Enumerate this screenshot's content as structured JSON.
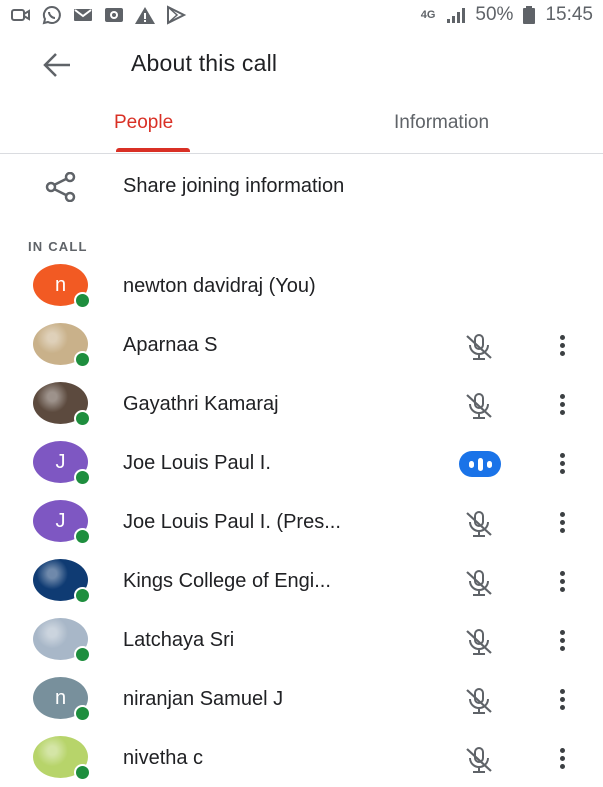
{
  "status_bar": {
    "left_icons": [
      "video-notification-icon",
      "whatsapp-icon",
      "mail-icon",
      "photo-icon",
      "warning-icon",
      "play-store-icon"
    ],
    "network_label": "4G",
    "battery": "50%",
    "time": "15:45"
  },
  "header": {
    "title": "About this call",
    "back_icon": "arrow-back-icon"
  },
  "tabs": [
    {
      "label": "People",
      "selected": true
    },
    {
      "label": "Information",
      "selected": false
    }
  ],
  "share": {
    "label": "Share joining information",
    "icon": "share-icon"
  },
  "section_label": "IN CALL",
  "participants": [
    {
      "name": "newton davidraj (You)",
      "avatar_letter": "n",
      "avatar_color": "#f25a23",
      "mic": "none"
    },
    {
      "name": "Aparnaa S",
      "avatar_letter": "",
      "avatar_color": "#c9b18a",
      "mic": "muted"
    },
    {
      "name": "Gayathri Kamaraj",
      "avatar_letter": "",
      "avatar_color": "#5c4a3e",
      "mic": "muted"
    },
    {
      "name": "Joe Louis Paul I.",
      "avatar_letter": "J",
      "avatar_color": "#7e57c2",
      "mic": "speaking"
    },
    {
      "name": "Joe Louis Paul I. (Pres...",
      "avatar_letter": "J",
      "avatar_color": "#7e57c2",
      "mic": "muted"
    },
    {
      "name": "Kings College of Engi...",
      "avatar_letter": "",
      "avatar_color": "#0f3b73",
      "mic": "muted"
    },
    {
      "name": "Latchaya Sri",
      "avatar_letter": "",
      "avatar_color": "#a8b7c8",
      "mic": "muted"
    },
    {
      "name": "niranjan Samuel J",
      "avatar_letter": "n",
      "avatar_color": "#78909c",
      "mic": "muted"
    },
    {
      "name": "nivetha c",
      "avatar_letter": "",
      "avatar_color": "#b7d46a",
      "mic": "muted"
    }
  ],
  "colors": {
    "accent": "#d93025",
    "presence": "#1e8e3e",
    "speaking": "#1a73e8",
    "text": "#202124",
    "secondary": "#5f6368"
  }
}
